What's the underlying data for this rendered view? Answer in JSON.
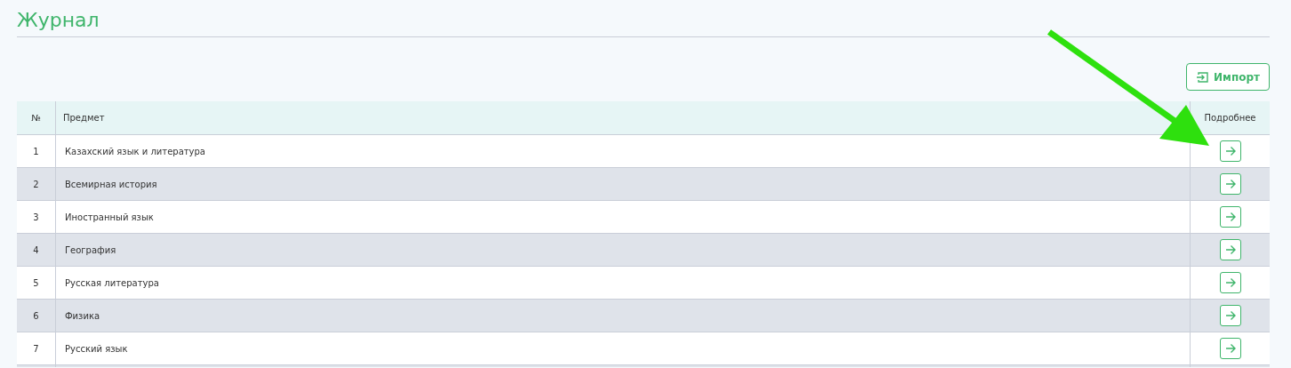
{
  "page": {
    "title": "Журнал"
  },
  "import_button": {
    "label": "Импорт"
  },
  "table": {
    "columns": [
      "№",
      "Предмет",
      "Подробнее"
    ],
    "rows": [
      {
        "number": "1",
        "subject": "Казахский язык и литература"
      },
      {
        "number": "2",
        "subject": "Всемирная история"
      },
      {
        "number": "3",
        "subject": "Иностранный язык"
      },
      {
        "number": "4",
        "subject": "География"
      },
      {
        "number": "5",
        "subject": "Русская литература"
      },
      {
        "number": "6",
        "subject": "Физика"
      },
      {
        "number": "7",
        "subject": "Русский язык"
      }
    ]
  }
}
